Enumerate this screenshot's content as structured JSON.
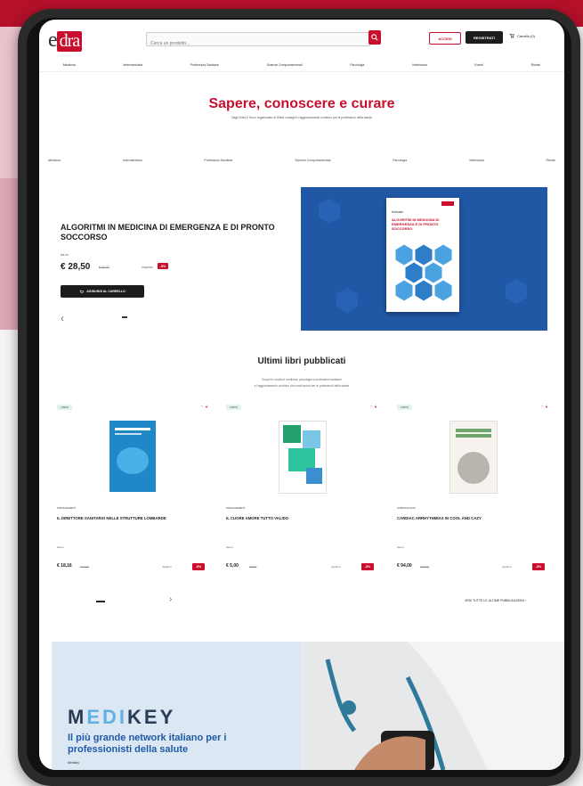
{
  "header": {
    "logo_prefix": "e",
    "logo_mark": "dra",
    "search_placeholder": "Cerca un prodotto...",
    "login_label": "ACCEDI",
    "register_label": "REGISTRATI",
    "cart_label": "Carrello (0)"
  },
  "nav": {
    "items": [
      "Medicina",
      "Infermieristica",
      "Professioni Sanitarie",
      "Scienze Comportamentali",
      "Psicologia",
      "Veterinaria",
      "Eventi",
      "Riviste"
    ]
  },
  "hero": {
    "title": "Sapere, conoscere e curare",
    "subtitle": "Dagli Edra il Trovo organizzato di Ultimi consigli e l'aggiornamento continuo per le professioni della salute"
  },
  "categories": {
    "items": [
      "Medicina",
      "Infermieristica",
      "Professioni Sanitarie",
      "Scienze Comportamentali",
      "Psicologia",
      "Veterinaria",
      "Riviste"
    ]
  },
  "featured": {
    "title": "ALGORITMI IN MEDICINA DI EMERGENZA E DI PRONTO SOCCORSO",
    "author": "Aa.vv.",
    "price": "€ 28,50",
    "old_price": "€ 30,00",
    "save_label": "risparmi",
    "badge": "-5%",
    "add_to_cart": "AGGIUNGI AL CARRELLO",
    "prev_icon": "chevron-left-icon",
    "slides_shown": 1,
    "cover_title_small": "Manuale",
    "cover_title": "ALGORITMI IN MEDICINA DI EMERGENZA E DI PRONTO SOCCORSO"
  },
  "latest": {
    "title": "Ultimi libri pubblicati",
    "subtitle_1": "Scopri le novità in medicina, psicologia e professioni sanitarie",
    "subtitle_2": "e l'aggiornamento continuo dei nostri autori per le professioni della salute",
    "cards": [
      {
        "tag": "LIBRO",
        "category": "MANAGEMENT",
        "title": "IL DIRETTORE SANITARIO NELLE STRUTTURE LOMBARDE",
        "authors": "Aa.vv.",
        "price": "€ 18,16",
        "old_price": "€ 19,90",
        "save_label": "risparmi",
        "badge": "-5%",
        "cover_color": "#1e88c8"
      },
      {
        "tag": "LIBRO",
        "category": "MANAGEMENT",
        "title": "IL CUORE AMORE TUTTO VALIDO",
        "authors": "Aa.vv.",
        "price": "€ 5,00",
        "old_price": "€ 5,50",
        "save_label": "risparmi",
        "badge": "-5%",
        "cover_color": "#23a06b"
      },
      {
        "tag": "LIBRO",
        "category": "CARDIOLOGIA",
        "title": "CARDIAC ARRHYTHMIAS IN COOL AND CAZY",
        "authors": "Aa.vv.",
        "price": "€ 94,00",
        "old_price": "€ 99,00",
        "save_label": "risparmi",
        "badge": "-5%",
        "cover_color": "#6ea76d"
      }
    ],
    "next_icon": "chevron-right-icon",
    "see_all": "VEDI TUTTE LE ULTIME PUBBLICAZIONI"
  },
  "medikey": {
    "logo_part1": "M",
    "logo_part2": "EDI",
    "logo_part3": "KEY",
    "headline": "Il più grande network italiano per i professionisti della salute",
    "subtext": "Medikey"
  },
  "colors": {
    "brand_red": "#c8102e",
    "dark": "#1c1c1c",
    "hero_blue": "#2158a6",
    "medikey_blue": "#1e5aa8"
  }
}
